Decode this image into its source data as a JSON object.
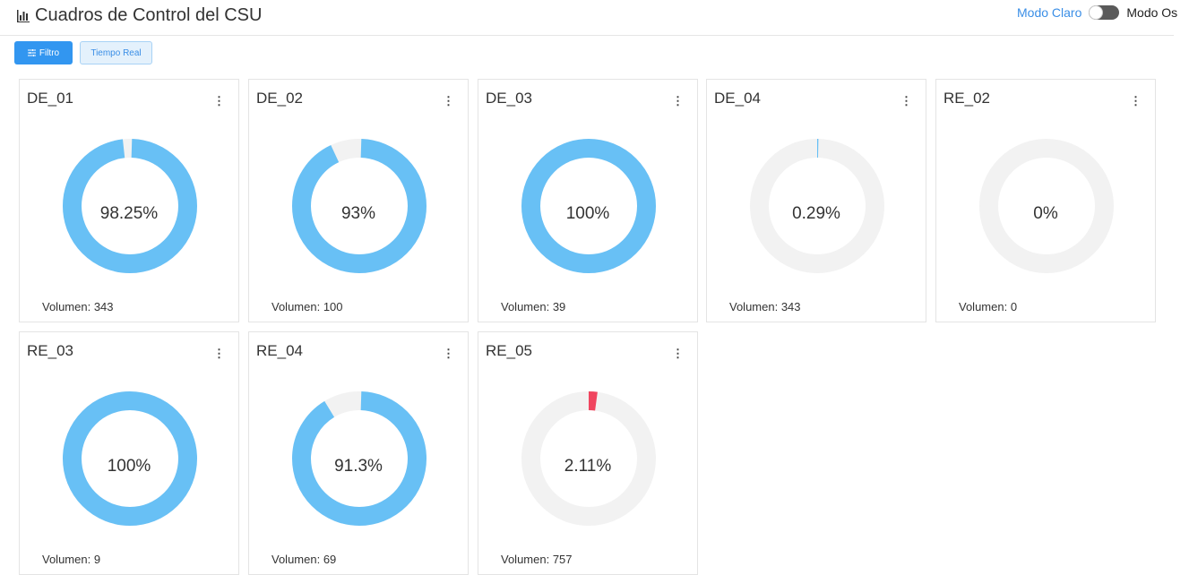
{
  "header": {
    "title": "Cuadros de Control del CSU",
    "mode_light_label": "Modo Claro",
    "mode_dark_label": "Modo Os"
  },
  "toolbar": {
    "filter_label": "Filtro",
    "realtime_label": "Tiempo Real"
  },
  "colors": {
    "fill": "#68c0f5",
    "alert": "#f0455f",
    "track": "#f2f2f2"
  },
  "cards": [
    {
      "name": "DE_01",
      "percent_label": "98.25%",
      "percent": 98.25,
      "volume_label": "Volumen: 343",
      "color": "#68c0f5"
    },
    {
      "name": "DE_02",
      "percent_label": "93%",
      "percent": 93,
      "volume_label": "Volumen: 100",
      "color": "#68c0f5"
    },
    {
      "name": "DE_03",
      "percent_label": "100%",
      "percent": 100,
      "volume_label": "Volumen: 39",
      "color": "#68c0f5"
    },
    {
      "name": "DE_04",
      "percent_label": "0.29%",
      "percent": 0.29,
      "volume_label": "Volumen: 343",
      "color": "#68c0f5"
    },
    {
      "name": "RE_02",
      "percent_label": "0%",
      "percent": 0,
      "volume_label": "Volumen: 0",
      "color": "#68c0f5"
    },
    {
      "name": "RE_03",
      "percent_label": "100%",
      "percent": 100,
      "volume_label": "Volumen: 9",
      "color": "#68c0f5"
    },
    {
      "name": "RE_04",
      "percent_label": "91.3%",
      "percent": 91.3,
      "volume_label": "Volumen: 69",
      "color": "#68c0f5"
    },
    {
      "name": "RE_05",
      "percent_label": "2.11%",
      "percent": 2.11,
      "volume_label": "Volumen: 757",
      "color": "#f0455f"
    }
  ]
}
